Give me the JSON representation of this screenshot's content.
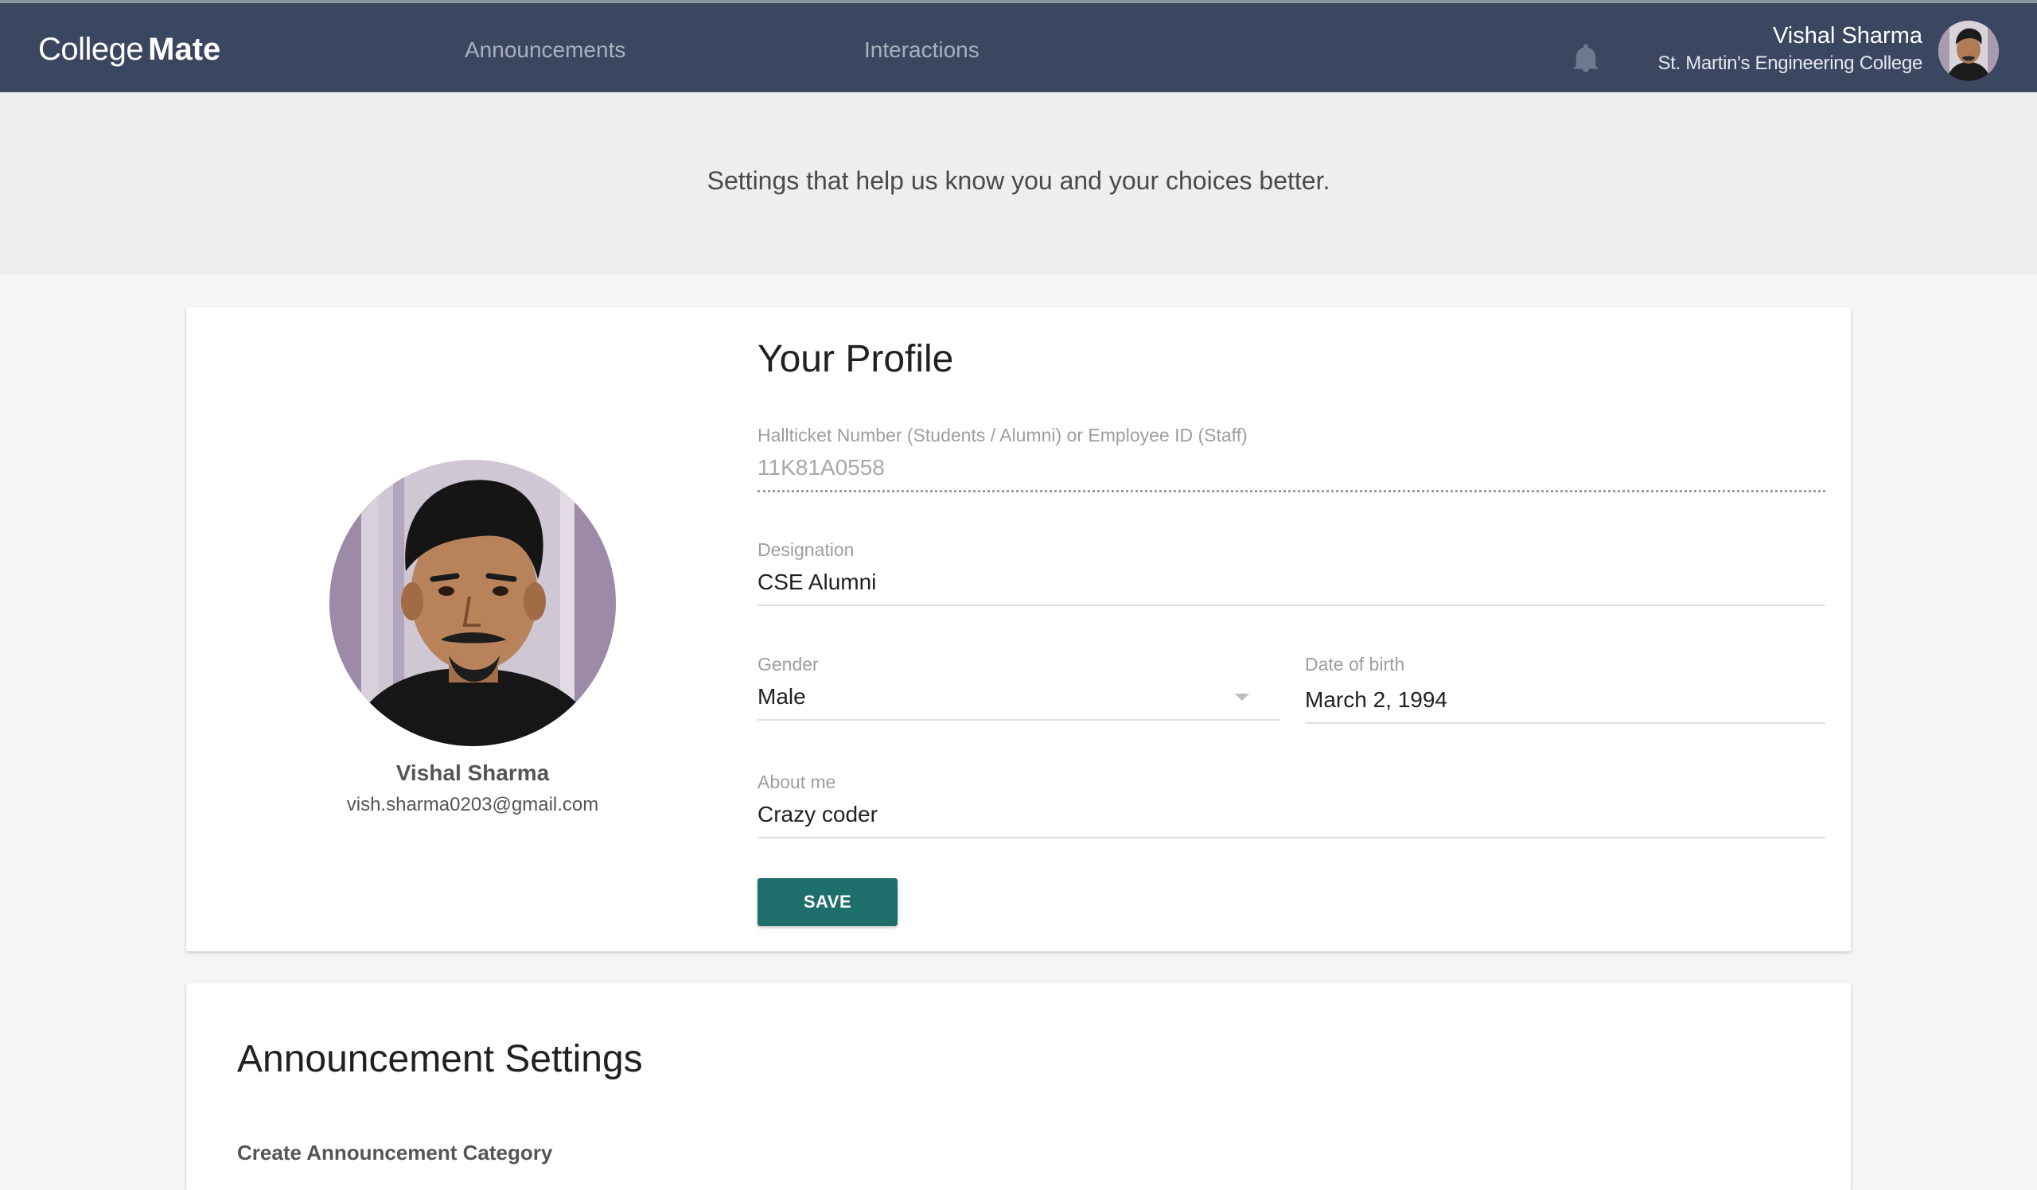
{
  "navbar": {
    "brand_light": "College",
    "brand_bold": "Mate",
    "links": [
      "Announcements",
      "Interactions"
    ],
    "bell_icon": "bell-icon",
    "user_name": "Vishal Sharma",
    "user_college": "St. Martin's Engineering College",
    "background_color": "#3b4660"
  },
  "banner": {
    "text": "Settings that help us know you and your choices better."
  },
  "profile": {
    "title": "Your Profile",
    "name": "Vishal Sharma",
    "email": "vish.sharma0203@gmail.com",
    "fields": {
      "hallticket": {
        "label": "Hallticket Number (Students / Alumni) or Employee ID (Staff)",
        "value": "11K81A0558"
      },
      "designation": {
        "label": "Designation",
        "value": "CSE Alumni"
      },
      "gender": {
        "label": "Gender",
        "value": "Male"
      },
      "dob": {
        "label": "Date of birth",
        "value": "March 2, 1994"
      },
      "about": {
        "label": "About me",
        "value": "Crazy coder"
      }
    },
    "save_label": "SAVE",
    "save_color": "#1e6e6c"
  },
  "announcement_settings": {
    "title": "Announcement Settings",
    "subtitle": "Create Announcement Category"
  }
}
